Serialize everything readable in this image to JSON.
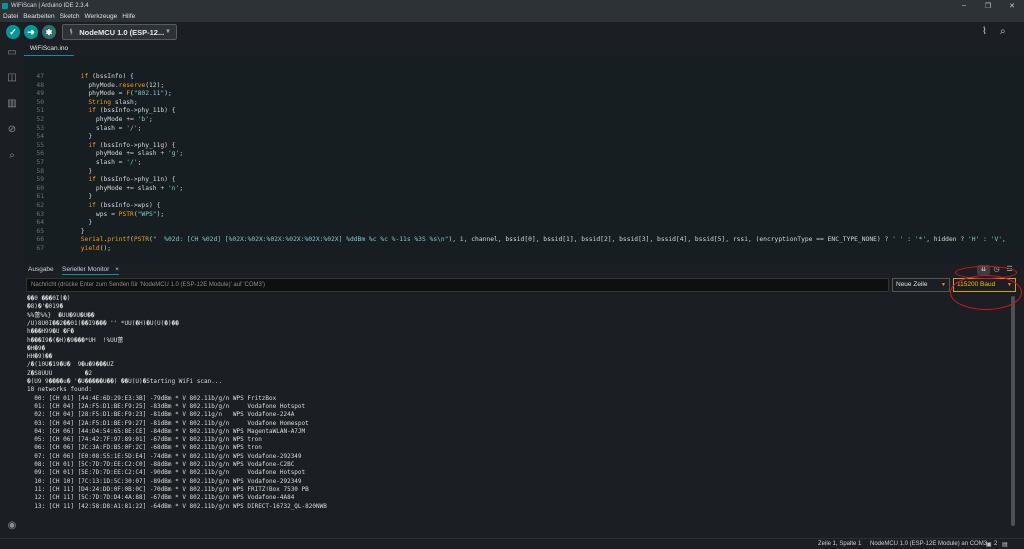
{
  "window": {
    "title": "WiFiScan | Arduino IDE 2.3.4",
    "controls": [
      "–",
      "❐",
      "✕"
    ]
  },
  "menu": [
    "Datei",
    "Bearbeiten",
    "Sketch",
    "Werkzeuge",
    "Hilfe"
  ],
  "toolbar": {
    "verify_icon": "check-icon",
    "upload_icon": "arrow-right-icon",
    "debug_icon": "debug-icon",
    "board": "NodeMCU 1.0 (ESP-12...",
    "right_icons": [
      "serial-plotter-icon",
      "serial-monitor-icon"
    ]
  },
  "sidebar": [
    "folder-icon",
    "boards-manager-icon",
    "library-icon",
    "debug-icon",
    "search-icon",
    "account-icon"
  ],
  "file_tab": "WiFiScan.ino",
  "editor": {
    "lines": [
      {
        "n": "47",
        "code": "      if (bssInfo) {"
      },
      {
        "n": "48",
        "code": "        phyMode.reserve(12);"
      },
      {
        "n": "49",
        "code": "        phyMode = F(\"802.11\");"
      },
      {
        "n": "50",
        "code": "        String slash;"
      },
      {
        "n": "51",
        "code": "        if (bssInfo->phy_11b) {"
      },
      {
        "n": "52",
        "code": "          phyMode += 'b';"
      },
      {
        "n": "53",
        "code": "          slash = '/';"
      },
      {
        "n": "54",
        "code": "        }"
      },
      {
        "n": "55",
        "code": "        if (bssInfo->phy_11g) {"
      },
      {
        "n": "56",
        "code": "          phyMode += slash + 'g';"
      },
      {
        "n": "57",
        "code": "          slash = '/';"
      },
      {
        "n": "58",
        "code": "        }"
      },
      {
        "n": "59",
        "code": "        if (bssInfo->phy_11n) {"
      },
      {
        "n": "60",
        "code": "          phyMode += slash + 'n';"
      },
      {
        "n": "61",
        "code": "        }"
      },
      {
        "n": "62",
        "code": "        if (bssInfo->wps) {"
      },
      {
        "n": "63",
        "code": "          wps = PSTR(\"WPS\");"
      },
      {
        "n": "64",
        "code": "        }"
      },
      {
        "n": "65",
        "code": "      }"
      },
      {
        "n": "66",
        "code": "      Serial.printf(PSTR(\"  %02d: [CH %02d] [%02X:%02X:%02X:%02X:%02X:%02X] %ddBm %c %c %-11s %3S %s\\n\"), i, channel, bssid[0], bssid[1], bssid[2], bssid[3], bssid[4], bssid[5], rssi, (encryptionType == ENC_TYPE_NONE) ? ' ' : '*', hidden ? 'H' : 'V',"
      },
      {
        "n": "67",
        "code": "      yield();"
      }
    ]
  },
  "panel": {
    "tab_output": "Ausgabe",
    "tab_monitor": "Serieller Monitor",
    "tab_close": "×",
    "message_placeholder": "Nachricht (drücke Enter zum Senden für 'NodeMCU 1.0 (ESP-12E Module)' auf 'COM3')",
    "line_ending": "Neue Zeile",
    "baud": "115200 Baud"
  },
  "monitor": {
    "lines": [
      "��0 ���0I(�)",
      "�8)�'�019�",
      "%%蕾%%}  �UU�9U�U��",
      "/U)8U0I��2��01(��I9��� '' *UU(�H)�U(U(�)��",
      "h���H99�U �F�",
      "h���I9�(�H)�9���*UH  !%UU蕾",
      "�H�9�",
      "HH�9)��",
      "/�(10U�19�U�  9�u�9���UZ",
      "Z�S8UUU         �2",
      "�(U9 9����u� '�U�����U��) ��U(U)�Starting WiFi scan...",
      "18 networks found:",
      "  00: [CH 01] [44:4E:6D:29:E3:3B] -79dBm * V 802.11b/g/n WPS FritzBox",
      "  01: [CH 04] [2A:F5:D1:BE:F9:25] -83dBm * V 802.11b/g/n     Vodafone Hotspot",
      "  02: [CH 04] [28:F5:D1:BE:F9:23] -81dBm * V 802.11g/n   WPS Vodafone-224A",
      "  03: [CH 04] [2A:F5:D1:BE:F9:27] -81dBm * V 802.11b/g/n     Vodafone Homespot",
      "  04: [CH 06] [44:D4:54:65:8E:CE] -84dBm * V 802.11b/g/n WPS MagentaWLAN-A7JM",
      "  05: [CH 06] [74:42:7F:97:89:01] -67dBm * V 802.11b/g/n WPS tron",
      "  06: [CH 06] [2C:3A:FD:B5:0F:2C] -68dBm * V 802.11b/g/n WPS tron",
      "  07: [CH 06] [E0:08:55:1E:5D:E4] -74dBm * V 802.11b/g/n WPS Vodafone-292349",
      "  08: [CH 01] [5C:7D:7D:EE:C2:C0] -88dBm * V 802.11b/g/n WPS Vodafone-C2BC",
      "  09: [CH 01] [5E:7D:7D:EE:C2:C4] -90dBm * V 802.11b/g/n     Vodafone Hotspot",
      "  10: [CH 10] [7C:13:1D:5C:30:07] -89dBm * V 802.11b/g/n WPS Vodafone-292349",
      "  11: [CH 11] [D4:24:DD:0F:0B:0C] -70dBm * V 802.11b/g/n WPS FRITZ!Box 7530 PB",
      "  12: [CH 11] [5C:7D:7D:D4:4A:88] -67dBm * V 802.11b/g/n WPS Vodafone-4A84",
      "  13: [CH 11] [42:58:D8:A1:81:22] -64dBm * V 802.11b/g/n WPS DIRECT-16732_QL-820NWB"
    ]
  },
  "status": {
    "position": "Zeile 1, Spalte 1",
    "board": "NodeMCU 1.0 (ESP-12E Module) an COM3",
    "notifications": "2"
  },
  "colors": {
    "accent": "#00979d",
    "annotation": "#d4141c",
    "baud_highlight": "#d8a200"
  }
}
